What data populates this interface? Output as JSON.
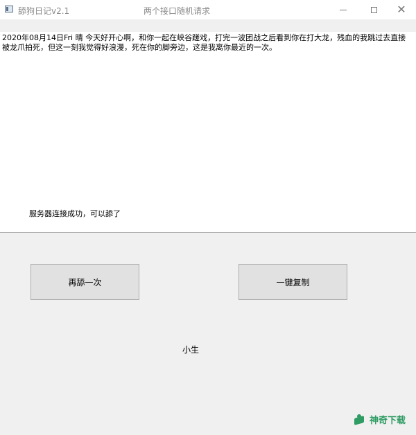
{
  "window": {
    "app_title": "舔狗日记v2.1",
    "caption": "两个接口随机请求",
    "minimize_symbol": "",
    "maximize_symbol": "",
    "close_symbol": "✕"
  },
  "content": {
    "diary_text": "2020年08月14日Fri 晴 今天好开心啊，和你一起在峡谷蹉戏，打完一波团战之后看到你在打大龙，残血的我跳过去直接被龙爪拍死，但这一刻我觉得好浪漫，死在你的脚旁边，这是我离你最近的一次。",
    "status": "服务器连接成功，可以舔了"
  },
  "buttons": {
    "retry_label": "再舔一次",
    "copy_label": "一键复制"
  },
  "footer": {
    "author": "小生",
    "watermark": "神奇下载"
  },
  "colors": {
    "watermark": "#2e9c63",
    "window_bg": "#f0f0f0",
    "button_bg": "#e1e1e1"
  }
}
